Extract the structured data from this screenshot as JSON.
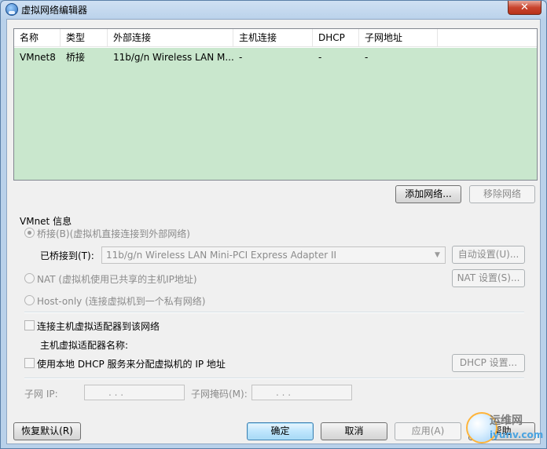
{
  "window": {
    "title": "虚拟网络编辑器",
    "close_label": "✕"
  },
  "list": {
    "columns": [
      "名称",
      "类型",
      "外部连接",
      "主机连接",
      "DHCP",
      "子网地址"
    ],
    "rows": [
      [
        "VMnet8",
        "桥接",
        "11b/g/n  Wireless LAN M...",
        "-",
        "-",
        "-"
      ]
    ]
  },
  "list_buttons": {
    "add": "添加网络...",
    "remove": "移除网络"
  },
  "vmnet_info": {
    "group_label": "VMnet 信息",
    "bridged_label": "桥接(B)(虚拟机直接连接到外部网络)",
    "bridged_to_label": "已桥接到(T):",
    "bridged_to_value": "11b/g/n  Wireless LAN Mini-PCI Express Adapter II",
    "auto_settings": "自动设置(U)...",
    "nat_label": "NAT (虚拟机使用已共享的主机IP地址)",
    "nat_settings": "NAT 设置(S)...",
    "hostonly_label": "Host-only (连接虚拟机到一个私有网络)",
    "connect_adapter_label": "连接主机虚拟适配器到该网络",
    "adapter_name_label": "主机虚拟适配器名称:",
    "dhcp_label": "使用本地 DHCP 服务来分配虚拟机的 IP 地址",
    "dhcp_settings": "DHCP 设置...",
    "subnet_ip_label": "子网 IP:",
    "subnet_ip_value": " .   .   . ",
    "subnet_mask_label": "子网掩码(M):",
    "subnet_mask_value": " .   .   . "
  },
  "footer": {
    "restore_defaults": "恢复默认(R)",
    "ok": "确定",
    "cancel": "取消",
    "apply": "应用(A)",
    "help": "帮助"
  },
  "watermark": {
    "line1": "运维网",
    "line2": "iyunv.com"
  }
}
